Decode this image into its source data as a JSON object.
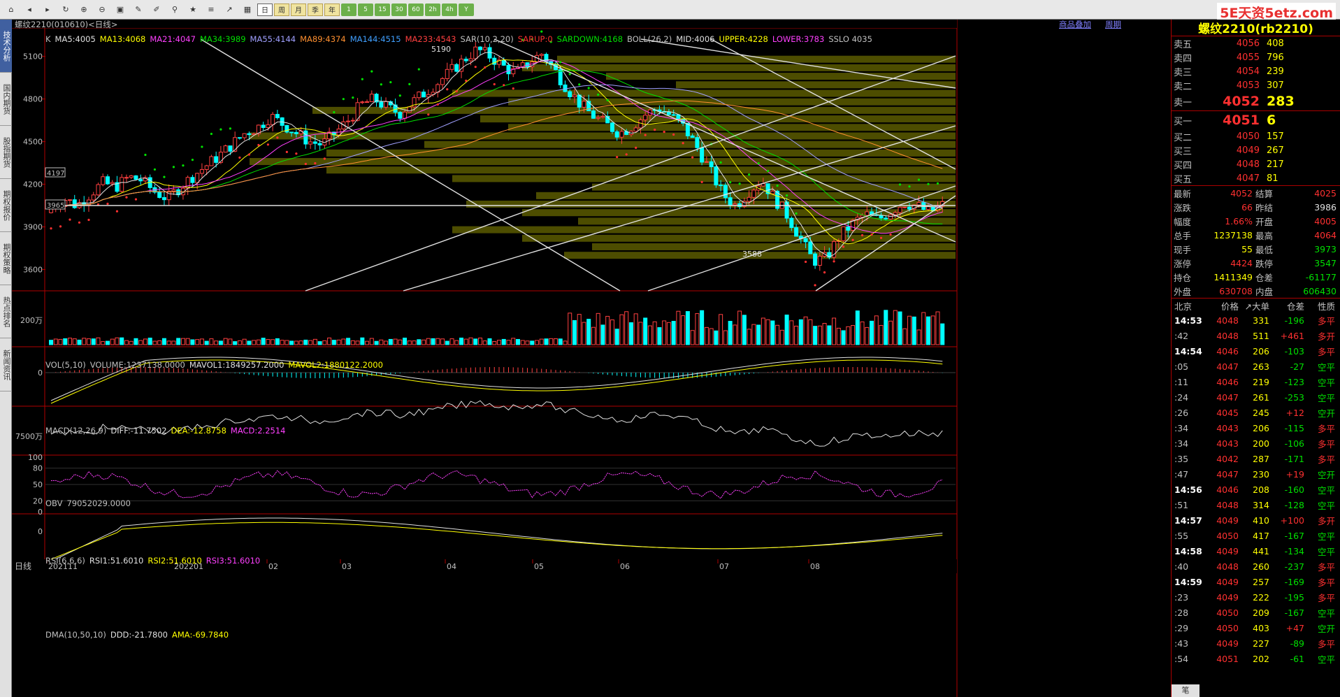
{
  "toolbar": {
    "icons": [
      "home-icon",
      "back-icon",
      "forward-icon",
      "refresh-icon",
      "zoom-in-icon",
      "zoom-out-icon",
      "window-icon",
      "draw-icon",
      "pen-icon",
      "filter-icon",
      "new-icon",
      "list-icon",
      "trend-icon",
      "chart-icon"
    ],
    "periods": [
      "日",
      "周",
      "月",
      "季",
      "年",
      "1",
      "5",
      "15",
      "30",
      "60",
      "2h",
      "4h",
      "Y"
    ],
    "selected_period": "日"
  },
  "brand": "5E天资5etz.com",
  "left_tabs": [
    "技术分析",
    "国内期货",
    "股指期货",
    "期权报价",
    "期权策略",
    "热点排名",
    "新闻资讯"
  ],
  "chart_header": {
    "symbol": "螺纹2210(010610)<日线>",
    "overlay_button": "商品叠加",
    "period_button": "周期"
  },
  "main_indicators": [
    {
      "t": "K",
      "c": "#c0c0c0"
    },
    {
      "t": "MA5:4005",
      "c": "#e0e0e0"
    },
    {
      "t": "MA13:4068",
      "c": "#ffff00"
    },
    {
      "t": "MA21:4047",
      "c": "#ff40ff"
    },
    {
      "t": "MA34:3989",
      "c": "#00e000"
    },
    {
      "t": "MA55:4144",
      "c": "#a0a0ff"
    },
    {
      "t": "MA89:4374",
      "c": "#ff9030"
    },
    {
      "t": "MA144:4515",
      "c": "#40a0ff"
    },
    {
      "t": "MA233:4543",
      "c": "#ff4040"
    },
    {
      "t": "SAR(10,2,20)",
      "c": "#c0c0c0"
    },
    {
      "t": "SARUP:0",
      "c": "#ff3030"
    },
    {
      "t": "SARDOWN:4168",
      "c": "#00e000"
    },
    {
      "t": "BOLL(26,2)",
      "c": "#c0c0c0"
    },
    {
      "t": "MID:4006",
      "c": "#e0e0e0"
    },
    {
      "t": "UPPER:4228",
      "c": "#ffff00"
    },
    {
      "t": "LOWER:3783",
      "c": "#ff40ff"
    },
    {
      "t": "SSLO 4035",
      "c": "#c0c0c0"
    }
  ],
  "annotations": {
    "high": "5190",
    "low": "3588",
    "box1": "4197",
    "box2": "3965"
  },
  "vol_indicators": [
    {
      "t": "VOL(5,10)",
      "c": "#c0c0c0"
    },
    {
      "t": "VOLUME:1237138.0000",
      "c": "#c0c0c0"
    },
    {
      "t": "MAVOL1:1849257.2000",
      "c": "#e0e0e0"
    },
    {
      "t": "MAVOL2:1880122.2000",
      "c": "#ffff00"
    }
  ],
  "macd_indicators": [
    {
      "t": "MACD(12,26,9)",
      "c": "#c0c0c0"
    },
    {
      "t": "DIFF:-11.7502",
      "c": "#e0e0e0"
    },
    {
      "t": "DEA:-12.8758",
      "c": "#ffff00"
    },
    {
      "t": "MACD:2.2514",
      "c": "#ff40ff"
    }
  ],
  "obv_indicators": [
    {
      "t": "OBV",
      "c": "#c0c0c0"
    },
    {
      "t": "79052029.0000",
      "c": "#c0c0c0"
    }
  ],
  "rsi_indicators": [
    {
      "t": "RSI(6,6,6)",
      "c": "#c0c0c0"
    },
    {
      "t": "RSI1:51.6010",
      "c": "#e0e0e0"
    },
    {
      "t": "RSI2:51.6010",
      "c": "#ffff00"
    },
    {
      "t": "RSI3:51.6010",
      "c": "#ff40ff"
    }
  ],
  "dma_indicators": [
    {
      "t": "DMA(10,50,10)",
      "c": "#c0c0c0"
    },
    {
      "t": "DDD:-21.7800",
      "c": "#e0e0e0"
    },
    {
      "t": "AMA:-69.7840",
      "c": "#ffff00"
    }
  ],
  "y_main": [
    "5100",
    "4800",
    "4500",
    "4200",
    "3900",
    "3600"
  ],
  "y_vol": "200万",
  "y_macd": "0",
  "y_obv": "7500万",
  "y_rsi": [
    "100",
    "80",
    "50",
    "20",
    "0"
  ],
  "y_dma": "0",
  "x_axis": {
    "period": "日线",
    "labels": [
      "202111",
      "202201",
      "02",
      "03",
      "04",
      "05",
      "06",
      "07",
      "08"
    ]
  },
  "right": {
    "title": "螺纹2210(rb2210)",
    "asks": [
      {
        "l": "卖五",
        "p": "4056",
        "v": "408"
      },
      {
        "l": "卖四",
        "p": "4055",
        "v": "796"
      },
      {
        "l": "卖三",
        "p": "4054",
        "v": "239"
      },
      {
        "l": "卖二",
        "p": "4053",
        "v": "307"
      },
      {
        "l": "卖一",
        "p": "4052",
        "v": "283"
      }
    ],
    "bids": [
      {
        "l": "买一",
        "p": "4051",
        "v": "6"
      },
      {
        "l": "买二",
        "p": "4050",
        "v": "157"
      },
      {
        "l": "买三",
        "p": "4049",
        "v": "267"
      },
      {
        "l": "买四",
        "p": "4048",
        "v": "217"
      },
      {
        "l": "买五",
        "p": "4047",
        "v": "81"
      }
    ],
    "quote": [
      {
        "a": "最新",
        "b": "4052",
        "bc": "red",
        "c": "结算",
        "d": "4025",
        "dc": "red"
      },
      {
        "a": "涨跌",
        "b": "66",
        "bc": "red",
        "c": "昨结",
        "d": "3986",
        "dc": "white"
      },
      {
        "a": "幅度",
        "b": "1.66%",
        "bc": "red",
        "c": "开盘",
        "d": "4005",
        "dc": "red"
      },
      {
        "a": "总手",
        "b": "1237138",
        "bc": "yellow",
        "c": "最高",
        "d": "4064",
        "dc": "red"
      },
      {
        "a": "现手",
        "b": "55",
        "bc": "yellow",
        "c": "最低",
        "d": "3973",
        "dc": "green"
      },
      {
        "a": "涨停",
        "b": "4424",
        "bc": "red",
        "c": "跌停",
        "d": "3547",
        "dc": "green"
      },
      {
        "a": "持仓",
        "b": "1411349",
        "bc": "yellow",
        "c": "仓差",
        "d": "-61177",
        "dc": "green"
      },
      {
        "a": "外盘",
        "b": "630708",
        "bc": "red",
        "c": "内盘",
        "d": "606430",
        "dc": "green"
      }
    ],
    "tick_header": {
      "city": "北京",
      "price": "价格",
      "vol": "↗大单",
      "diff": "仓差",
      "nature": "性质"
    },
    "ticks": [
      {
        "t": "14:53",
        "p": "4048",
        "v": "331",
        "d": "-196",
        "n": "多平"
      },
      {
        "t": ":42",
        "p": "4048",
        "v": "511",
        "d": "+461",
        "n": "多开"
      },
      {
        "t": "14:54",
        "p": "4046",
        "v": "206",
        "d": "-103",
        "n": "多平"
      },
      {
        "t": ":05",
        "p": "4047",
        "v": "263",
        "d": "-27",
        "n": "空平"
      },
      {
        "t": ":11",
        "p": "4046",
        "v": "219",
        "d": "-123",
        "n": "空平"
      },
      {
        "t": ":24",
        "p": "4047",
        "v": "261",
        "d": "-253",
        "n": "空平"
      },
      {
        "t": ":26",
        "p": "4045",
        "v": "245",
        "d": "+12",
        "n": "空开"
      },
      {
        "t": ":34",
        "p": "4043",
        "v": "206",
        "d": "-115",
        "n": "多平"
      },
      {
        "t": ":34",
        "p": "4043",
        "v": "200",
        "d": "-106",
        "n": "多平"
      },
      {
        "t": ":35",
        "p": "4042",
        "v": "287",
        "d": "-171",
        "n": "多平"
      },
      {
        "t": ":47",
        "p": "4047",
        "v": "230",
        "d": "+19",
        "n": "空开"
      },
      {
        "t": "14:56",
        "p": "4046",
        "v": "208",
        "d": "-160",
        "n": "空平"
      },
      {
        "t": ":51",
        "p": "4048",
        "v": "314",
        "d": "-128",
        "n": "空平"
      },
      {
        "t": "14:57",
        "p": "4049",
        "v": "410",
        "d": "+100",
        "n": "多开"
      },
      {
        "t": ":55",
        "p": "4050",
        "v": "417",
        "d": "-167",
        "n": "空平"
      },
      {
        "t": "14:58",
        "p": "4049",
        "v": "441",
        "d": "-134",
        "n": "空平"
      },
      {
        "t": ":40",
        "p": "4048",
        "v": "260",
        "d": "-237",
        "n": "多平"
      },
      {
        "t": "14:59",
        "p": "4049",
        "v": "257",
        "d": "-169",
        "n": "多平"
      },
      {
        "t": ":23",
        "p": "4049",
        "v": "222",
        "d": "-195",
        "n": "多平"
      },
      {
        "t": ":28",
        "p": "4050",
        "v": "209",
        "d": "-167",
        "n": "空平"
      },
      {
        "t": ":29",
        "p": "4050",
        "v": "403",
        "d": "+47",
        "n": "空开"
      },
      {
        "t": ":43",
        "p": "4049",
        "v": "227",
        "d": "-89",
        "n": "多平"
      },
      {
        "t": ":54",
        "p": "4051",
        "v": "202",
        "d": "-61",
        "n": "空平"
      }
    ],
    "bottom_tab": "笔"
  },
  "chart_data": {
    "type": "candlestick",
    "title": "螺纹2210(010610)<日线>",
    "ylim": [
      3450,
      5300
    ],
    "close_path": [
      4030,
      4100,
      4050,
      4130,
      4210,
      4180,
      4250,
      4230,
      4150,
      4100,
      4180,
      4260,
      4330,
      4400,
      4480,
      4560,
      4600,
      4680,
      4620,
      4560,
      4500,
      4480,
      4560,
      4650,
      4760,
      4800,
      4740,
      4700,
      4780,
      4850,
      4920,
      5000,
      5080,
      5150,
      5100,
      5030,
      4980,
      5060,
      5120,
      5000,
      4870,
      4760,
      4680,
      4620,
      4560,
      4610,
      4690,
      4740,
      4680,
      4600,
      4460,
      4300,
      4130,
      4050,
      4150,
      4230,
      4100,
      3980,
      3820,
      3660,
      3680,
      3830,
      3920,
      3990,
      3950,
      4010,
      4070,
      4050,
      4000,
      4052
    ]
  }
}
